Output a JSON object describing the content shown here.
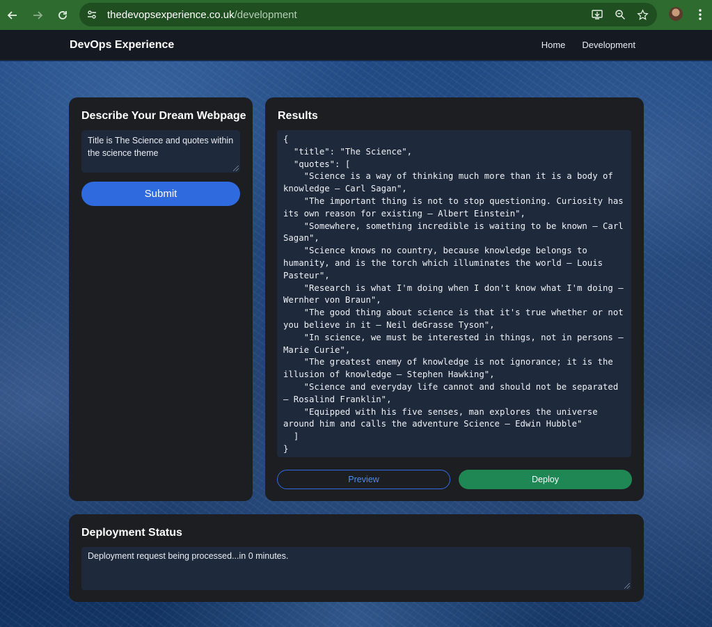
{
  "browser": {
    "url_host": "thedevopsexperience.co.uk",
    "url_path": "/development",
    "icons": [
      "back-arrow-icon",
      "forward-arrow-icon",
      "reload-icon",
      "site-info-icon",
      "install-app-icon",
      "zoom-icon",
      "bookmark-star-icon",
      "profile-avatar",
      "menu-kebab-icon"
    ]
  },
  "header": {
    "brand": "DevOps Experience",
    "nav": {
      "home": "Home",
      "development": "Development"
    }
  },
  "prompt_card": {
    "title": "Describe Your Dream Webpage",
    "input_value": "Title is The Science and quotes within the science theme",
    "submit_label": "Submit"
  },
  "results_card": {
    "title": "Results",
    "json_text": "{\n  \"title\": \"The Science\",\n  \"quotes\": [\n    \"Science is a way of thinking much more than it is a body of knowledge – Carl Sagan\",\n    \"The important thing is not to stop questioning. Curiosity has its own reason for existing – Albert Einstein\",\n    \"Somewhere, something incredible is waiting to be known – Carl Sagan\",\n    \"Science knows no country, because knowledge belongs to humanity, and is the torch which illuminates the world – Louis Pasteur\",\n    \"Research is what I'm doing when I don't know what I'm doing – Wernher von Braun\",\n    \"The good thing about science is that it's true whether or not you believe in it – Neil deGrasse Tyson\",\n    \"In science, we must be interested in things, not in persons – Marie Curie\",\n    \"The greatest enemy of knowledge is not ignorance; it is the illusion of knowledge – Stephen Hawking\",\n    \"Science and everyday life cannot and should not be separated – Rosalind Franklin\",\n    \"Equipped with his five senses, man explores the universe around him and calls the adventure Science – Edwin Hubble\"\n  ]\n}",
    "preview_label": "Preview",
    "deploy_label": "Deploy"
  },
  "status_card": {
    "title": "Deployment Status",
    "message": "Deployment request being processed...in 0 minutes."
  },
  "colors": {
    "browser_green": "#2e6b2f",
    "header_bg": "#151a22",
    "card_bg": "#1d1e21",
    "field_bg": "#1e293b",
    "primary_blue": "#2f6bdf",
    "deploy_green": "#1f8754"
  }
}
